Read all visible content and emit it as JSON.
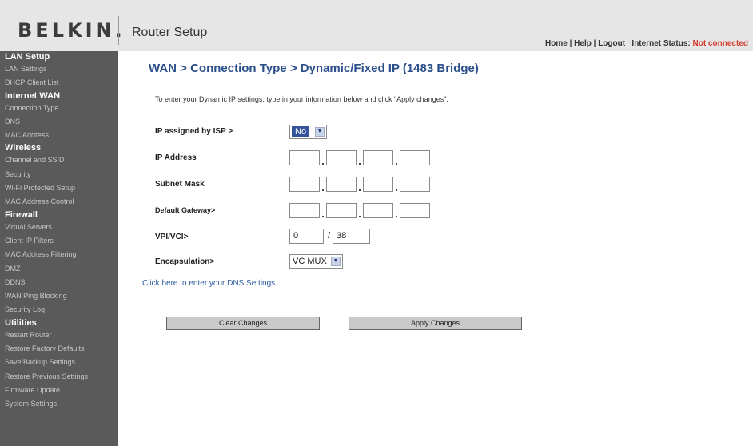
{
  "header": {
    "logo": "BELKIN.",
    "title": "Router Setup",
    "links": [
      "Home",
      "Help",
      "Logout"
    ],
    "status_label": "Internet Status:",
    "status_value": "Not connected"
  },
  "sidebar": {
    "sections": [
      {
        "title": "LAN Setup",
        "items": [
          "LAN Settings",
          "DHCP Client List"
        ]
      },
      {
        "title": "Internet WAN",
        "items": [
          "Connection Type",
          "DNS",
          "MAC Address"
        ]
      },
      {
        "title": "Wireless",
        "items": [
          "Channel and SSID",
          "Security",
          "Wi-Fi Protected Setup",
          "MAC Address Control"
        ]
      },
      {
        "title": "Firewall",
        "items": [
          "Virtual Servers",
          "Client IP Filters",
          "MAC Address Filtering",
          "DMZ",
          "DDNS",
          "WAN Ping Blocking",
          "Security Log"
        ]
      },
      {
        "title": "Utilities",
        "items": [
          "Restart Router",
          "Restore Factory Defaults",
          "Save/Backup Settings",
          "Restore Previous Settings",
          "Firmware Update",
          "System Settings"
        ]
      }
    ]
  },
  "main": {
    "page_title": "WAN > Connection Type > Dynamic/Fixed IP (1483 Bridge)",
    "instructions": "To enter your Dynamic IP settings, type in your information below and click \"Apply changes\".",
    "ip_assigned_label": "IP assigned by ISP >",
    "ip_assigned_value": "No",
    "ip_address_label": "IP Address",
    "subnet_label": "Subnet Mask",
    "gateway_label": "Default Gateway>",
    "vpivci_label": "VPI/VCI>",
    "vpi_value": "0",
    "vci_value": "38",
    "encapsulation_label": "Encapsulation>",
    "encapsulation_value": "VC MUX",
    "dns_link": "Click here to enter your DNS Settings",
    "clear_button": "Clear Changes",
    "apply_button": "Apply Changes"
  }
}
